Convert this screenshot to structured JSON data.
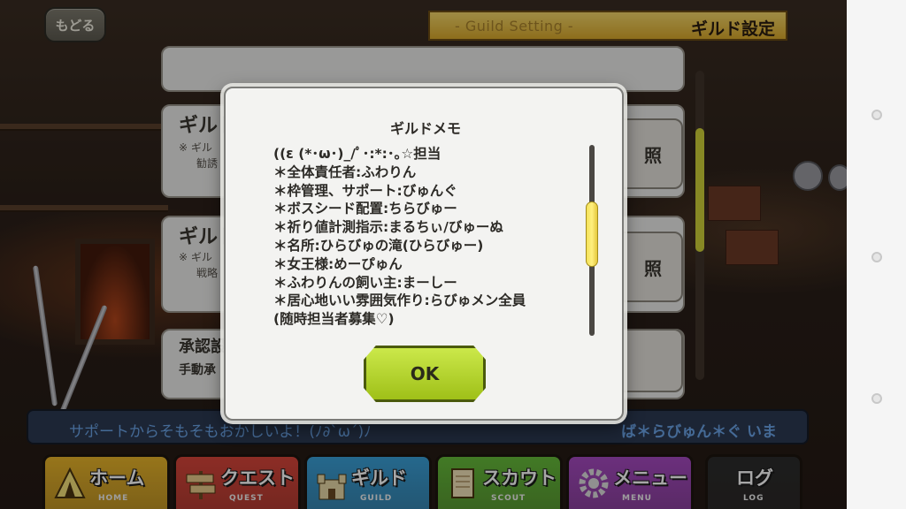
{
  "header": {
    "back_label": "もどる",
    "subtitle_en": "- Guild Setting -",
    "title_jp": "ギルド設定"
  },
  "background_panels": [
    {
      "title": "ギルド",
      "lines": [
        "※ ギル",
        "勧誘"
      ],
      "button_label": "照"
    },
    {
      "title": "ギルド",
      "lines": [
        "※ ギル",
        "戦略"
      ],
      "button_label": "照"
    },
    {
      "title": "承認設",
      "lines": [
        "手動承"
      ]
    }
  ],
  "modal": {
    "title": "ギルドメモ",
    "memo_lines": [
      "((ε (*･ω･)_/ﾟ･:*:･｡☆担当",
      "＊全体責任者:ふわりん",
      "＊枠管理、サポート:びゅんぐ",
      "＊ボスシード配置:ちらびゅー",
      "＊祈り値計測指示:まるちぃ/びゅーぬ",
      "＊名所:ひらびゅの滝(ひらびゅー)",
      "＊女王様:めーぴゅん",
      "＊ふわりんの飼い主:まーしー",
      "＊居心地いい雰囲気作り:らびゅメン全員",
      "(随時担当者募集♡)"
    ],
    "ok_label": "OK",
    "scroll_position": 0.45
  },
  "chat": {
    "message": "サポートからそもそもおかしいよ！(ﾉ∂`ω´)ﾉ",
    "user": "ば＊らびゅん＊ぐ いま"
  },
  "nav": [
    {
      "label": "ホーム",
      "sub": "HOME",
      "icon": "tent-icon",
      "color": "#e8b42a"
    },
    {
      "label": "クエスト",
      "sub": "QUEST",
      "icon": "signpost-icon",
      "color": "#d8453a"
    },
    {
      "label": "ギルド",
      "sub": "GUILD",
      "icon": "castle-icon",
      "color": "#3aa0d8"
    },
    {
      "label": "スカウト",
      "sub": "SCOUT",
      "icon": "scroll-icon",
      "color": "#66bb3a"
    },
    {
      "label": "メニュー",
      "sub": "MENU",
      "icon": "gear-icon",
      "color": "#a54ac0"
    },
    {
      "label": "ログ",
      "sub": "LOG",
      "icon": "log-icon",
      "color": "#2c2c2c"
    }
  ]
}
